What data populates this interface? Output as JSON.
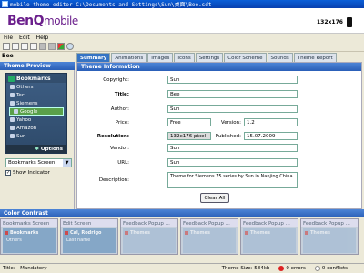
{
  "window": {
    "title": "mobile theme editor C:\\Documents and Settings\\Sun\\桌面\\Bee.sdt"
  },
  "header": {
    "logo_brand": "BenQ",
    "logo_product": "mobile",
    "resolution": "132x176"
  },
  "menu": {
    "file": "File",
    "edit": "Edit",
    "help": "Help"
  },
  "theme_name": "Bee",
  "tabs": [
    "Summary",
    "Animations",
    "Images",
    "Icons",
    "Settings",
    "Color Scheme",
    "Sounds",
    "Theme Report"
  ],
  "preview": {
    "header": "Theme Preview",
    "phone_title": "Bookmarks",
    "items": [
      "Others",
      "Tec",
      "Siemens",
      "Google",
      "Yahoo",
      "Amazon",
      "Sun"
    ],
    "selected_index": 3,
    "softkey": "Options",
    "screen_select": "Bookmarks Screen",
    "show_indicator_label": "Show Indicator"
  },
  "info": {
    "header": "Theme Information",
    "copyright_label": "Copyright:",
    "copyright": "Sun",
    "title_label": "Title:",
    "title": "Bee",
    "author_label": "Author:",
    "author": "Sun",
    "price_label": "Price:",
    "price": "Free",
    "version_label": "Version:",
    "version": "1.2",
    "resolution_label": "Resolution:",
    "resolution": "132x176 pixel",
    "published_label": "Published:",
    "published": "15.07.2009",
    "vendor_label": "Vendor:",
    "vendor": "Sun",
    "url_label": "URL:",
    "url": "Sun",
    "description_label": "Description:",
    "description": "Theme for Siemens 75 series by Sun in Nanjing China",
    "clear_all": "Clear All"
  },
  "contrast": {
    "header": "Color Contrast",
    "thumbs": [
      {
        "title": "Bookmarks Screen",
        "line1": "Bookmarks",
        "line2": "Others"
      },
      {
        "title": "Edit Screen",
        "line1": "Cal, Rodrigo",
        "line2": "Last name"
      },
      {
        "title": "Feedback Popup ...",
        "line1": "Themes",
        "line2": ""
      },
      {
        "title": "Feedback Popup ...",
        "line1": "Themes",
        "line2": ""
      },
      {
        "title": "Feedback Popup ...",
        "line1": "Themes",
        "line2": ""
      },
      {
        "title": "Feedback Popup ...",
        "line1": "Themes",
        "line2": ""
      }
    ]
  },
  "status": {
    "title": "Title: - Mandatory",
    "size": "Theme Size: 584kb",
    "errors": "0 errors",
    "conflicts": "0 conflicts"
  }
}
